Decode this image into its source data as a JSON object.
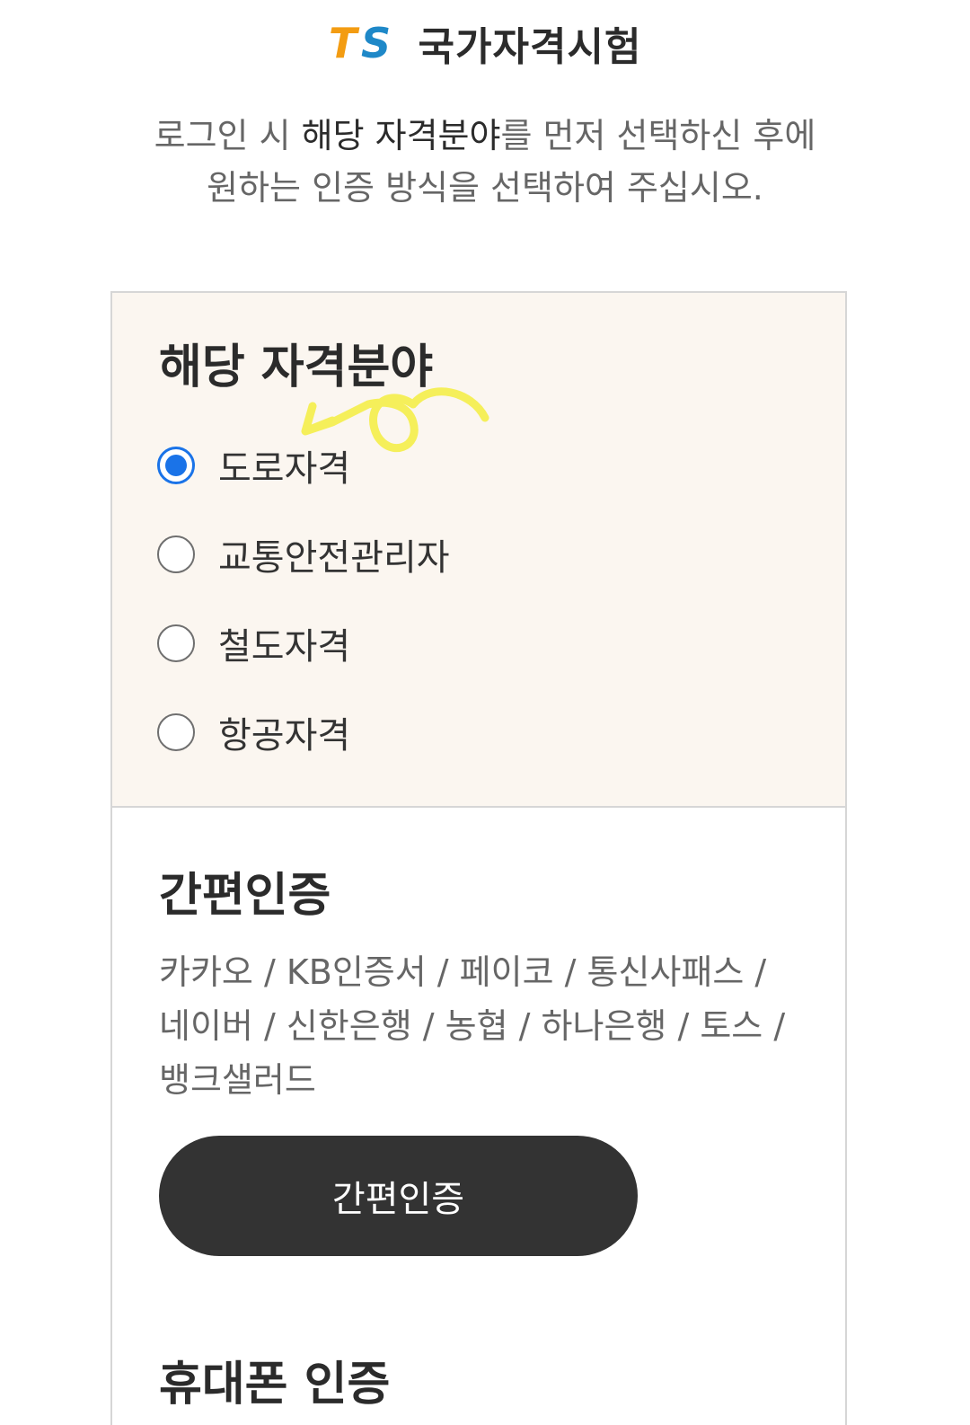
{
  "header": {
    "logo_text": "TS",
    "title": "국가자격시험"
  },
  "instructions": {
    "line1_prefix": "로그인 시 ",
    "line1_strong": "해당 자격분야",
    "line1_suffix": "를 먼저 선택하신 후에",
    "line2": "원하는 인증 방식을 선택하여 주십시오."
  },
  "field_section": {
    "title": "해당 자격분야",
    "options": [
      {
        "label": "도로자격",
        "checked": true
      },
      {
        "label": "교통안전관리자",
        "checked": false
      },
      {
        "label": "철도자격",
        "checked": false
      },
      {
        "label": "항공자격",
        "checked": false
      }
    ]
  },
  "simple_auth": {
    "title": "간편인증",
    "description": "카카오 / KB인증서 / 페이코 / 통신사패스 / 네이버 / 신한은행 / 농협 / 하나은행 / 토스 / 뱅크샐러드",
    "button_label": "간편인증"
  },
  "phone_auth": {
    "title": "휴대폰 인증"
  },
  "colors": {
    "accent": "#1a73e8",
    "field_bg": "#fbf6f0",
    "button_bg": "#333333",
    "logo_orange": "#f39c12",
    "logo_blue": "#1e88c8",
    "scribble": "#f5ef5a"
  }
}
